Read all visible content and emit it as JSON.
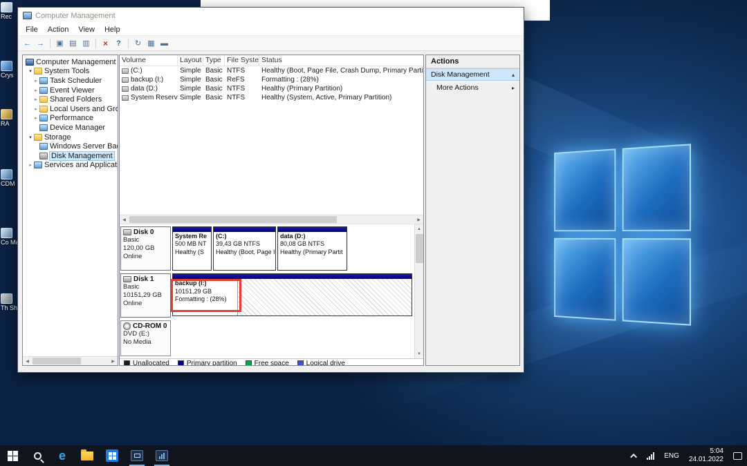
{
  "desktop": {
    "icons": [
      {
        "label": "Rec"
      },
      {
        "label": "Crys"
      },
      {
        "label": "RA"
      },
      {
        "label": "CDM"
      },
      {
        "label": "Co Man"
      },
      {
        "label": "Th Sh"
      }
    ]
  },
  "window": {
    "title": "Computer Management",
    "menu": [
      "File",
      "Action",
      "View",
      "Help"
    ],
    "toolbar": {
      "icons": [
        {
          "name": "back",
          "glyph": "←"
        },
        {
          "name": "forward",
          "glyph": "→"
        },
        {
          "name": "show-console-tree",
          "glyph": "▣"
        },
        {
          "name": "export-list",
          "glyph": "▤"
        },
        {
          "name": "properties",
          "glyph": "▥"
        },
        {
          "name": "delete",
          "glyph": "×"
        },
        {
          "name": "help",
          "glyph": "?"
        },
        {
          "name": "refresh",
          "glyph": "↻"
        },
        {
          "name": "details-view",
          "glyph": "▦"
        },
        {
          "name": "disk-view",
          "glyph": "▬"
        }
      ]
    },
    "tree": {
      "root": "Computer Management (Local",
      "items": [
        {
          "label": "System Tools",
          "arrow": "▾"
        },
        {
          "label": "Task Scheduler",
          "arrow": "▸"
        },
        {
          "label": "Event Viewer",
          "arrow": "▸"
        },
        {
          "label": "Shared Folders",
          "arrow": "▸"
        },
        {
          "label": "Local Users and Groups",
          "arrow": "▸"
        },
        {
          "label": "Performance",
          "arrow": "▸"
        },
        {
          "label": "Device Manager",
          "arrow": ""
        },
        {
          "label": "Storage",
          "arrow": "▾"
        },
        {
          "label": "Windows Server Backup",
          "arrow": ""
        },
        {
          "label": "Disk Management",
          "arrow": ""
        },
        {
          "label": "Services and Applications",
          "arrow": "▸"
        }
      ]
    },
    "volume_table": {
      "columns": [
        "Volume",
        "Layout",
        "Type",
        "File System",
        "Status"
      ],
      "rows": [
        {
          "volume": "(C:)",
          "layout": "Simple",
          "type": "Basic",
          "fs": "NTFS",
          "status": "Healthy (Boot, Page File, Crash Dump, Primary Partition)"
        },
        {
          "volume": "backup (I:)",
          "layout": "Simple",
          "type": "Basic",
          "fs": "ReFS",
          "status": "Formatting : (28%)"
        },
        {
          "volume": "data (D:)",
          "layout": "Simple",
          "type": "Basic",
          "fs": "NTFS",
          "status": "Healthy (Primary Partition)"
        },
        {
          "volume": "System Reserved",
          "layout": "Simple",
          "type": "Basic",
          "fs": "NTFS",
          "status": "Healthy (System, Active, Primary Partition)"
        }
      ]
    },
    "disks": [
      {
        "label": "Disk 0",
        "type": "Basic",
        "size": "120,00 GB",
        "status": "Online",
        "partitions": [
          {
            "name": "System Re",
            "size": "500 MB NT",
            "status": "Healthy (S"
          },
          {
            "name": "(C:)",
            "size": "39,43 GB NTFS",
            "status": "Healthy (Boot, Page I"
          },
          {
            "name": "data (D:)",
            "size": "80,08 GB NTFS",
            "status": "Healthy (Primary Partit"
          }
        ]
      },
      {
        "label": "Disk 1",
        "type": "Basic",
        "size": "10151,29 GB",
        "status": "Online",
        "partitions": [
          {
            "name": "backup (I:)",
            "size": "10151,29 GB",
            "status": "Formatting : (28%)"
          }
        ]
      },
      {
        "label": "CD-ROM 0",
        "media": "DVD (E:)",
        "status": "No Media"
      }
    ],
    "legend": [
      {
        "label": "Unallocated",
        "color": "#1c1c1c"
      },
      {
        "label": "Primary partition",
        "color": "#000080"
      },
      {
        "label": "Free space",
        "color": "#00a650"
      },
      {
        "label": "Logical drive",
        "color": "#3f51d8"
      }
    ],
    "actions": {
      "title": "Actions",
      "items": [
        {
          "label": "Disk Management",
          "arrow": "▴"
        },
        {
          "label": "More Actions",
          "arrow": "▸"
        }
      ]
    }
  },
  "taskbar": {
    "tray": {
      "language": "ENG",
      "time": "5:04",
      "date": "24.01.2022"
    }
  }
}
